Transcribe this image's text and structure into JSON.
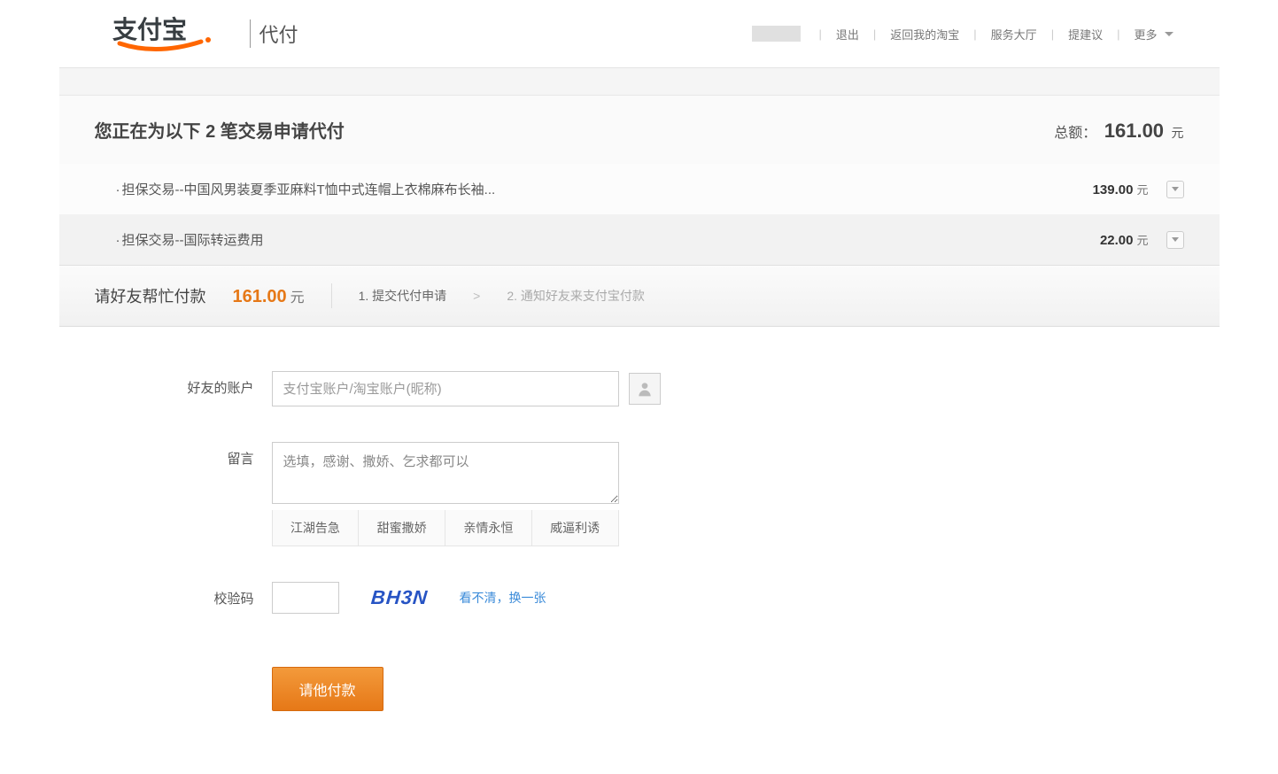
{
  "header": {
    "logo_sub": "代付",
    "nav": {
      "logout": "退出",
      "back_taobao": "返回我的淘宝",
      "service": "服务大厅",
      "feedback": "提建议",
      "more": "更多"
    }
  },
  "title": {
    "prefix": "您正在为以下 ",
    "count": "2",
    "suffix": " 笔交易申请代付",
    "total_label": "总额：",
    "total_amount": "161.00",
    "unit": "元"
  },
  "transactions": [
    {
      "name": "担保交易--中国风男装夏季亚麻料T恤中式连帽上衣棉麻布长袖...",
      "price": "139.00",
      "unit": "元"
    },
    {
      "name": "担保交易--国际转运费用",
      "price": "22.00",
      "unit": "元"
    }
  ],
  "stepbar": {
    "label": "请好友帮忙付款",
    "amount": "161.00",
    "unit": "元",
    "step1": "1. 提交代付申请",
    "arrow": ">",
    "step2": "2. 通知好友来支付宝付款"
  },
  "form": {
    "account_label": "好友的账户",
    "account_placeholder": "支付宝账户/淘宝账户(昵称)",
    "message_label": "留言",
    "message_placeholder": "选填，感谢、撒娇、乞求都可以",
    "presets": [
      "江湖告急",
      "甜蜜撒娇",
      "亲情永恒",
      "威逼利诱"
    ],
    "captcha_label": "校验码",
    "captcha_text": "BH3N",
    "captcha_refresh": "看不清，换一张",
    "submit": "请他付款"
  }
}
